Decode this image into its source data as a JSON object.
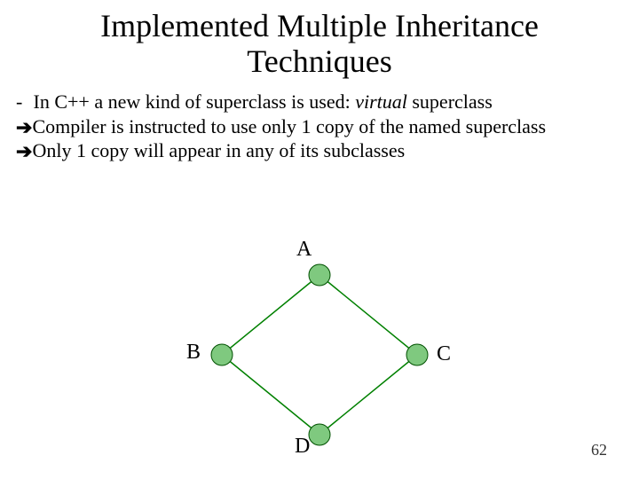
{
  "title": "Implemented Multiple Inheritance Techniques",
  "bullets": {
    "dash": "-",
    "b1_pre": "In C++ a new kind of superclass is used:  ",
    "b1_emph": "virtual",
    "b1_post": " superclass",
    "arrow": "➔",
    "b2": "Compiler is instructed to use only 1 copy of the named superclass",
    "b3": "Only 1 copy will appear in any of its subclasses"
  },
  "diagram": {
    "labels": {
      "a": "A",
      "b": "B",
      "c": "C",
      "d": "D"
    }
  },
  "page_number": "62"
}
